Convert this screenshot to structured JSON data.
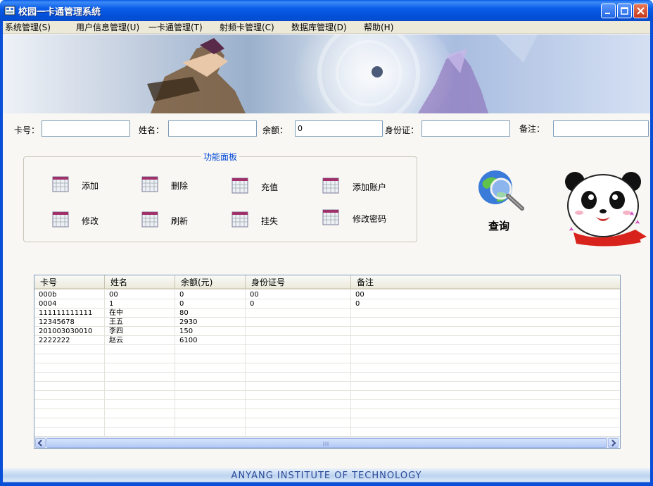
{
  "window": {
    "title": "校园一卡通管理系统"
  },
  "menu": [
    "系统管理(S)",
    "用户信息管理(U)",
    "一卡通管理(T)",
    "射频卡管理(C)",
    "数据库管理(D)",
    "帮助(H)"
  ],
  "form": {
    "card_label": "卡号：",
    "card_value": "",
    "name_label": "姓名：",
    "name_value": "",
    "balance_label": "余额：",
    "balance_value": "0",
    "id_label": "身份证：",
    "id_value": "",
    "note_label": "备注：",
    "note_value": ""
  },
  "function_panel": {
    "title": "功能面板",
    "buttons": [
      "添加",
      "删除",
      "充值",
      "添加账户",
      "修改",
      "刷新",
      "挂失",
      "修改密码"
    ]
  },
  "search": {
    "label": "查询"
  },
  "table": {
    "columns": [
      "卡号",
      "姓名",
      "余额(元)",
      "身份证号",
      "备注"
    ],
    "rows": [
      [
        "000b",
        "00",
        "0",
        "00",
        "00"
      ],
      [
        "0004",
        "1",
        "0",
        "0",
        "0"
      ],
      [
        "111111111111",
        "在中",
        "80",
        "",
        ""
      ],
      [
        "12345678",
        "王五",
        "2930",
        "",
        ""
      ],
      [
        "201003030010",
        "李四",
        "150",
        "",
        ""
      ],
      [
        "2222222",
        "赵云",
        "6100",
        "",
        ""
      ]
    ]
  },
  "footer": {
    "text": "ANYANG INSTITUTE OF TECHNOLOGY"
  },
  "colors": {
    "titlebar": "#0a5ce8",
    "panel_title": "#0046d5",
    "footer_text": "#2a4a9a"
  }
}
